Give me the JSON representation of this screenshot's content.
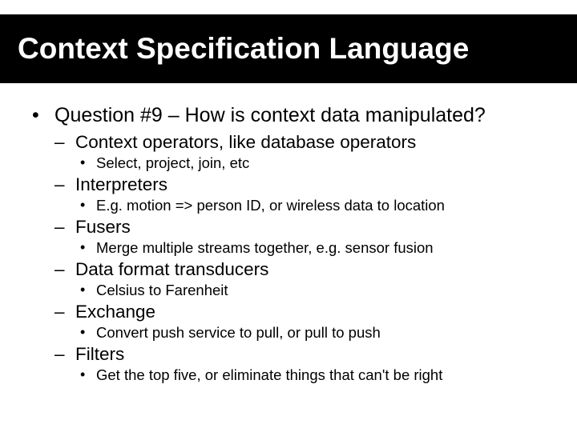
{
  "title": "Context Specification Language",
  "bullet1": "Question #9 – How is context data manipulated?",
  "items": [
    {
      "label": "Context operators, like database operators",
      "sub": "Select, project, join, etc"
    },
    {
      "label": "Interpreters",
      "sub": "E.g. motion => person ID, or wireless data to location"
    },
    {
      "label": "Fusers",
      "sub": "Merge multiple streams together, e.g. sensor fusion"
    },
    {
      "label": "Data format transducers",
      "sub": "Celsius to Farenheit"
    },
    {
      "label": "Exchange",
      "sub": "Convert push service to pull, or pull to push"
    },
    {
      "label": "Filters",
      "sub": "Get the top five, or eliminate things that can't be right"
    }
  ]
}
